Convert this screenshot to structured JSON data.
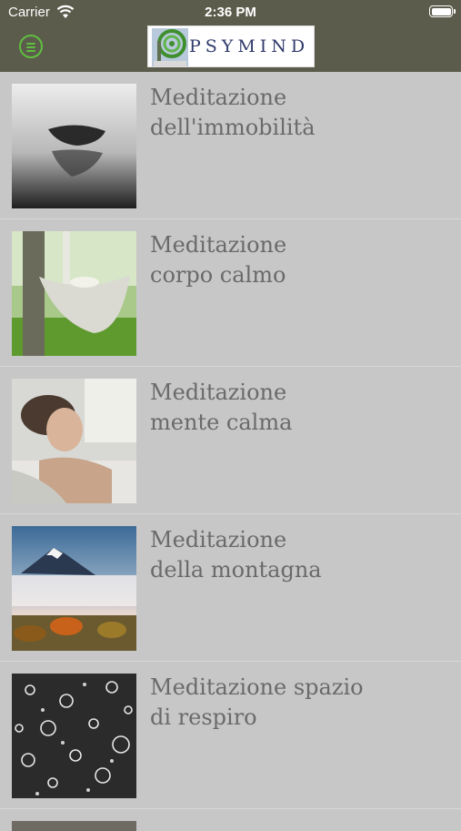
{
  "status": {
    "carrier": "Carrier",
    "time": "2:36 PM"
  },
  "header": {
    "logo_text": "PSYMIND"
  },
  "items": [
    {
      "line1": "Meditazione",
      "line2": "dell'immobilità",
      "image": "boat-on-water"
    },
    {
      "line1": "Meditazione",
      "line2": "corpo calmo",
      "image": "hammock"
    },
    {
      "line1": "Meditazione",
      "line2": "mente calma",
      "image": "relaxing-woman"
    },
    {
      "line1": "Meditazione",
      "line2": "della montagna",
      "image": "mountain"
    },
    {
      "line1": "Meditazione spazio",
      "line2": "di respiro",
      "image": "bubbles"
    }
  ]
}
